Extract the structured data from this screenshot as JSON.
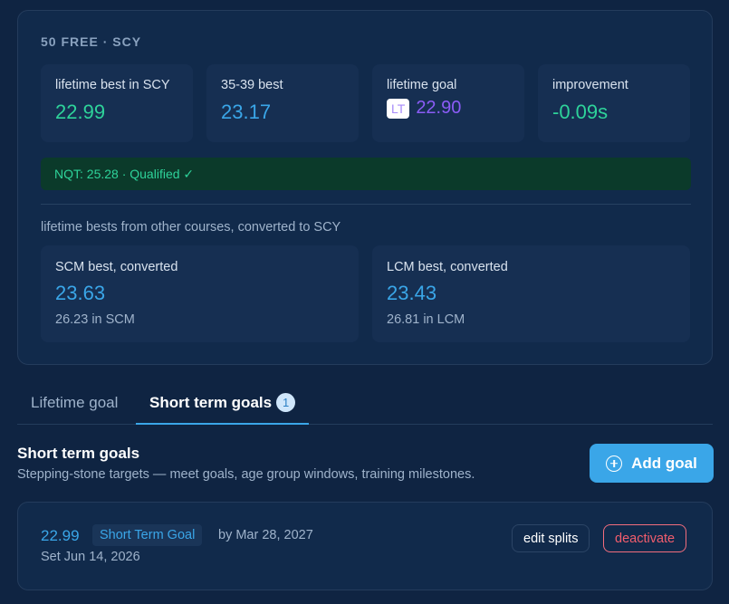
{
  "event": {
    "title": "50 FREE · SCY"
  },
  "stats": [
    {
      "label": "lifetime best in SCY",
      "value": "22.99"
    },
    {
      "label": "35-39 best",
      "value": "23.17"
    },
    {
      "label": "lifetime goal",
      "badge": "LT",
      "value": "22.90"
    },
    {
      "label": "improvement",
      "value": "-0.09s"
    }
  ],
  "nqt": {
    "text": "NQT: 25.28 · Qualified ✓"
  },
  "converted": {
    "caption": "lifetime bests from other courses, converted to SCY",
    "cards": [
      {
        "label": "SCM best, converted",
        "value": "23.63",
        "sub": "26.23 in SCM"
      },
      {
        "label": "LCM best, converted",
        "value": "23.43",
        "sub": "26.81 in LCM"
      }
    ]
  },
  "tabs": [
    {
      "label": "Lifetime goal"
    },
    {
      "label": "Short term goals",
      "count": "1"
    }
  ],
  "section": {
    "title": "Short term goals",
    "subtitle": "Stepping-stone targets — meet goals, age group windows, training milestones.",
    "add_button": "Add goal"
  },
  "goals": [
    {
      "time": "22.99",
      "type": "Short Term Goal",
      "by": "by Mar 28, 2027",
      "set": "Set Jun 14, 2026",
      "edit_label": "edit splits",
      "deactivate_label": "deactivate"
    }
  ],
  "colors": {
    "background": "#0f2442",
    "accent": "#3aa6e8",
    "success": "#2ed39a",
    "goal_purple": "#8b5cf6",
    "danger": "#f25d6d"
  }
}
